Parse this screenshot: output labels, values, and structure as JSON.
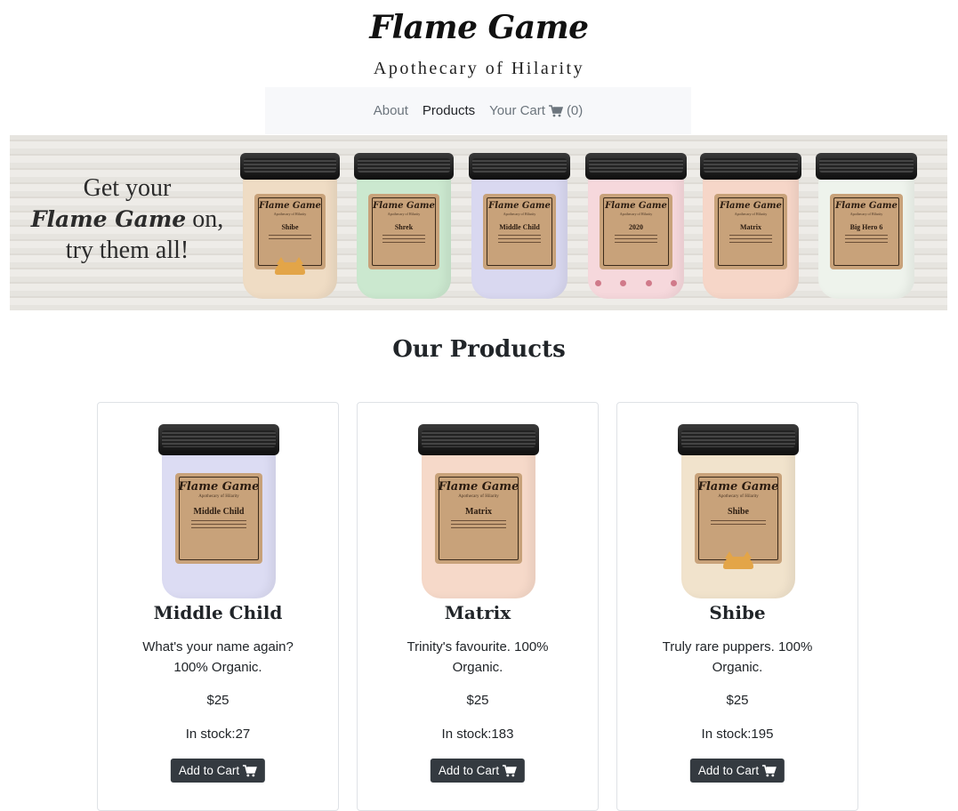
{
  "header": {
    "brand": "Flame Game",
    "tagline": "Apothecary of Hilarity"
  },
  "nav": {
    "about": "About",
    "products": "Products",
    "cart_label": "Your Cart",
    "cart_count": "(0)"
  },
  "banner": {
    "line1": "Get your",
    "line2_brand": "Flame Game",
    "line2_rest": " on,",
    "line3": "try them all!",
    "jars": [
      {
        "brand": "Flame Game",
        "sub": "Apothecary of Hilarity",
        "name": "Shibe",
        "color": "#efdcc4"
      },
      {
        "brand": "Flame Game",
        "sub": "Apothecary of Hilarity",
        "name": "Shrek",
        "color": "#cbe8cf"
      },
      {
        "brand": "Flame Game",
        "sub": "Apothecary of Hilarity",
        "name": "Middle Child",
        "color": "#d9d8f0"
      },
      {
        "brand": "Flame Game",
        "sub": "Apothecary of Hilarity",
        "name": "2020",
        "color": "#f6d8dc"
      },
      {
        "brand": "Flame Game",
        "sub": "Apothecary of Hilarity",
        "name": "Matrix",
        "color": "#f6d6c8"
      },
      {
        "brand": "Flame Game",
        "sub": "Apothecary of Hilarity",
        "name": "Big Hero 6",
        "color": "#eef3ec"
      }
    ]
  },
  "section_title": "Our Products",
  "products": [
    {
      "name": "Middle Child",
      "description": "What's your name again? 100% Organic.",
      "price": "$25",
      "stock": "In stock:27",
      "button": "Add to Cart",
      "label_brand": "Flame Game",
      "label_sub": "Apothecary of Hilarity",
      "label_name": "Middle Child",
      "color": "#dcdcf3"
    },
    {
      "name": "Matrix",
      "description": "Trinity's favourite. 100% Organic.",
      "price": "$25",
      "stock": "In stock:183",
      "button": "Add to Cart",
      "label_brand": "Flame Game",
      "label_sub": "Apothecary of Hilarity",
      "label_name": "Matrix",
      "color": "#f6d9c9"
    },
    {
      "name": "Shibe",
      "description": "Truly rare puppers. 100% Organic.",
      "price": "$25",
      "stock": "In stock:195",
      "button": "Add to Cart",
      "label_brand": "Flame Game",
      "label_sub": "Apothecary of Hilarity",
      "label_name": "Shibe",
      "color": "#f1e3cc"
    }
  ],
  "icons": {
    "cart": "shopping-cart-icon"
  },
  "colors": {
    "button_bg": "#343a40",
    "navbar_bg": "#f7f8fa",
    "nav_link": "#6c757d",
    "nav_active": "#1f2226"
  }
}
